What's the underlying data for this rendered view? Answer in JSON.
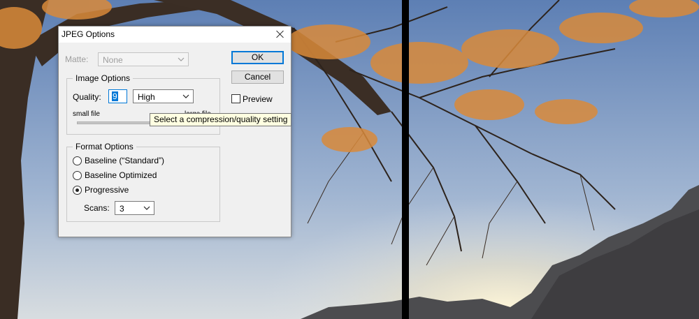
{
  "dialog": {
    "title": "JPEG Options",
    "matte": {
      "label": "Matte:",
      "value": "None",
      "enabled": false
    },
    "image_options": {
      "title": "Image Options",
      "quality_label": "Quality:",
      "quality_value": "9",
      "quality_preset": "High",
      "small_file_label": "small file",
      "large_file_label": "large file"
    },
    "format_options": {
      "title": "Format Options",
      "options": [
        "Baseline (“Standard”)",
        "Baseline Optimized",
        "Progressive"
      ],
      "selected": "Progressive",
      "scans_label": "Scans:",
      "scans_value": "3"
    },
    "buttons": {
      "ok": "OK",
      "cancel": "Cancel"
    },
    "preview": {
      "label": "Preview",
      "checked": false
    },
    "tooltip": "Select a compression/quality setting"
  },
  "colors": {
    "accent": "#0078d7",
    "dialog_bg": "#f0f0f0",
    "tooltip_bg": "#ffffe1"
  }
}
